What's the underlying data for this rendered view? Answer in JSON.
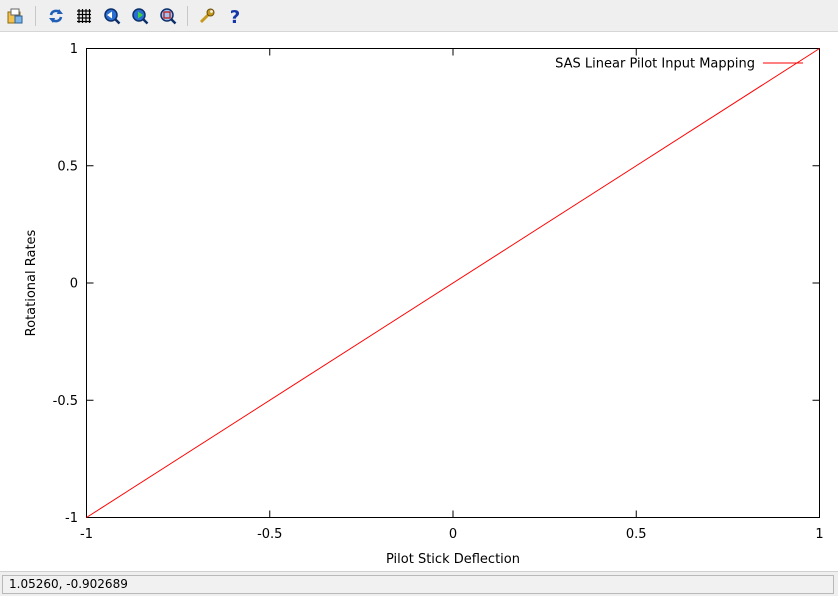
{
  "toolbar": {
    "buttons": [
      {
        "name": "export-button",
        "icon": "export-icon"
      },
      {
        "name": "replot-button",
        "icon": "replot-icon"
      },
      {
        "name": "grid-button",
        "icon": "grid-icon"
      },
      {
        "name": "zoom-previous-button",
        "icon": "zoom-previous-icon"
      },
      {
        "name": "zoom-next-button",
        "icon": "zoom-next-icon"
      },
      {
        "name": "unzoom-button",
        "icon": "unzoom-icon"
      },
      {
        "name": "settings-button",
        "icon": "wrench-icon"
      },
      {
        "name": "help-button",
        "icon": "help-icon"
      }
    ]
  },
  "status": {
    "coordinates": "1.05260, -0.902689"
  },
  "colors": {
    "series": "#ff0000",
    "axes": "#000000"
  },
  "chart_data": {
    "type": "line",
    "title": "",
    "xlabel": "Pilot Stick Deflection",
    "ylabel": "Rotational Rates",
    "xlim": [
      -1,
      1
    ],
    "ylim": [
      -1,
      1
    ],
    "x_ticks": [
      -1,
      -0.5,
      0,
      0.5,
      1
    ],
    "y_ticks": [
      -1,
      -0.5,
      0,
      0.5,
      1
    ],
    "x_tick_labels": [
      "-1",
      "-0.5",
      "0",
      "0.5",
      "1"
    ],
    "y_tick_labels": [
      "-1",
      "-0.5",
      "0",
      "0.5",
      "1"
    ],
    "grid": false,
    "legend_position": "top-right",
    "series": [
      {
        "name": "SAS Linear Pilot Input Mapping",
        "color": "#ff0000",
        "x": [
          -1,
          1
        ],
        "y": [
          -1,
          1
        ]
      }
    ]
  }
}
